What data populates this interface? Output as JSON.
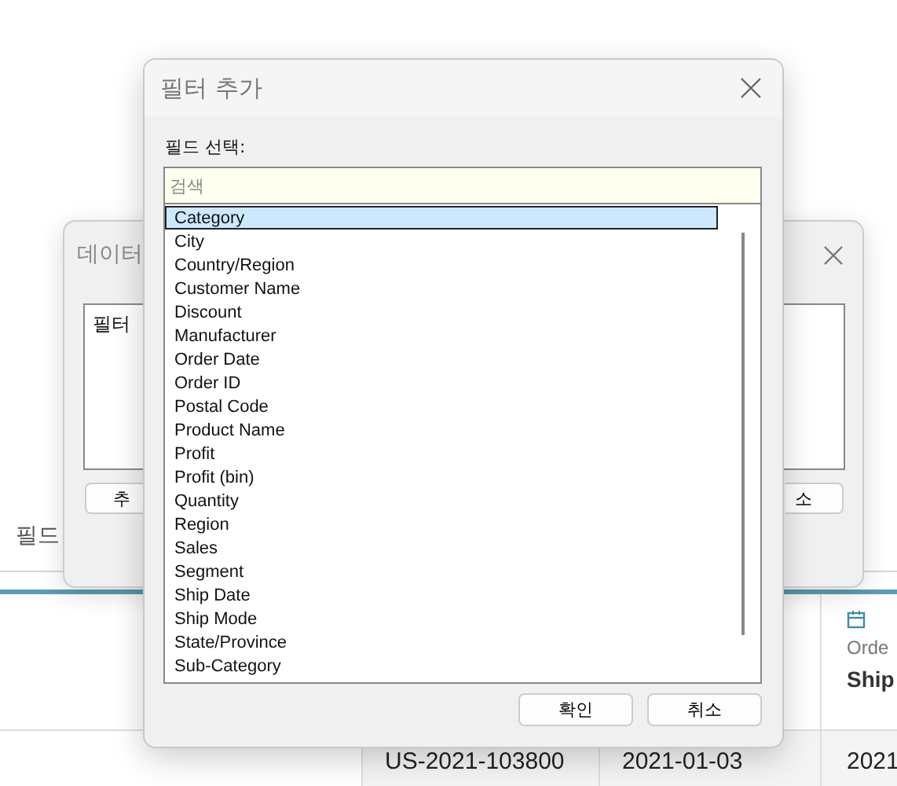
{
  "background": {
    "field_label": "필드",
    "table": {
      "header": {
        "column_4_label": "Orde",
        "column_4_subtitle": "Ship"
      },
      "row": [
        "US-2021-103800",
        "2021-01-03",
        "2021"
      ]
    }
  },
  "back_dialog": {
    "title": "데이터",
    "list_item": "필터",
    "left_button": "추",
    "right_button": "소"
  },
  "dialog": {
    "title": "필터 추가",
    "field_label": "필드 선택:",
    "search": {
      "placeholder": "검색"
    },
    "fields": [
      {
        "label": "Category",
        "selected": true
      },
      {
        "label": "City",
        "selected": false
      },
      {
        "label": "Country/Region",
        "selected": false
      },
      {
        "label": "Customer Name",
        "selected": false
      },
      {
        "label": "Discount",
        "selected": false
      },
      {
        "label": "Manufacturer",
        "selected": false
      },
      {
        "label": "Order Date",
        "selected": false
      },
      {
        "label": "Order ID",
        "selected": false
      },
      {
        "label": "Postal Code",
        "selected": false
      },
      {
        "label": "Product Name",
        "selected": false
      },
      {
        "label": "Profit",
        "selected": false
      },
      {
        "label": "Profit (bin)",
        "selected": false
      },
      {
        "label": "Quantity",
        "selected": false
      },
      {
        "label": "Region",
        "selected": false
      },
      {
        "label": "Sales",
        "selected": false
      },
      {
        "label": "Segment",
        "selected": false
      },
      {
        "label": "Ship Date",
        "selected": false
      },
      {
        "label": "Ship Mode",
        "selected": false
      },
      {
        "label": "State/Province",
        "selected": false
      },
      {
        "label": "Sub-Category",
        "selected": false
      }
    ],
    "buttons": [
      "확인",
      "취소"
    ]
  }
}
